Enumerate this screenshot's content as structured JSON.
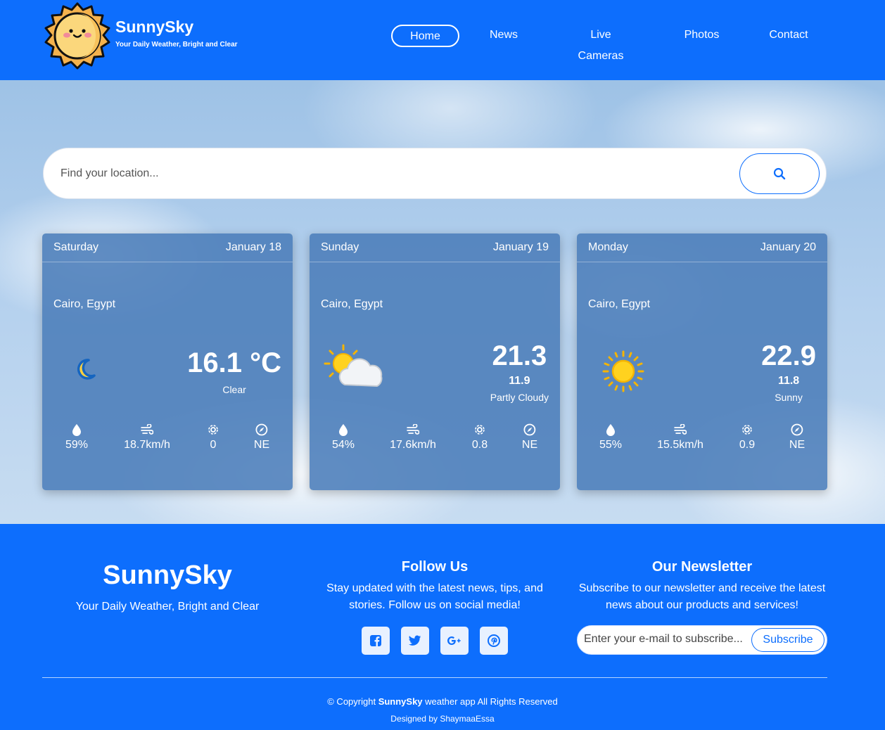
{
  "header": {
    "brand_name": "SunnySky",
    "brand_tagline": "Your Daily Weather, Bright and Clear",
    "nav": [
      {
        "label": "Home",
        "active": true
      },
      {
        "label": "News"
      },
      {
        "label": "Live Cameras"
      },
      {
        "label": "Photos"
      },
      {
        "label": "Contact"
      }
    ]
  },
  "search": {
    "placeholder": "Find your location...",
    "icon": "search-icon"
  },
  "forecast": [
    {
      "day": "Saturday",
      "date": "January 18",
      "city": "Cairo, Egypt",
      "icon": "crescent-moon-icon",
      "temp": "16.1 °C",
      "temp_min": "",
      "condition": "Clear",
      "humidity": "59%",
      "wind": "18.7km/h",
      "uv": "0",
      "direction": "NE"
    },
    {
      "day": "Sunday",
      "date": "January 19",
      "city": "Cairo, Egypt",
      "icon": "partly-cloudy-icon",
      "temp": "21.3",
      "temp_min": "11.9",
      "condition": "Partly Cloudy",
      "humidity": "54%",
      "wind": "17.6km/h",
      "uv": "0.8",
      "direction": "NE"
    },
    {
      "day": "Monday",
      "date": "January 20",
      "city": "Cairo, Egypt",
      "icon": "sun-icon",
      "temp": "22.9",
      "temp_min": "11.8",
      "condition": "Sunny",
      "humidity": "55%",
      "wind": "15.5km/h",
      "uv": "0.9",
      "direction": "NE"
    }
  ],
  "footer": {
    "brand_name": "SunnySky",
    "brand_tagline": "Your Daily Weather, Bright and Clear",
    "follow_title": "Follow Us",
    "follow_text": "Stay updated with the latest news, tips, and stories. Follow us on social media!",
    "socials": [
      "facebook-icon",
      "twitter-icon",
      "google-plus-icon",
      "pinterest-icon"
    ],
    "newsletter_title": "Our Newsletter",
    "newsletter_text": "Subscribe to our newsletter and receive the latest news about our products and services!",
    "email_placeholder": "Enter your e-mail to subscribe...",
    "subscribe_label": "Subscribe",
    "copyright_prefix": "© Copyright ",
    "copyright_brand": "SunnySky",
    "copyright_suffix": " weather app All Rights Reserved",
    "designed_by": "Designed by ShaymaaEssa"
  },
  "colors": {
    "primary": "#0d6efd",
    "card": "#4b7db9",
    "white": "#ffffff"
  }
}
